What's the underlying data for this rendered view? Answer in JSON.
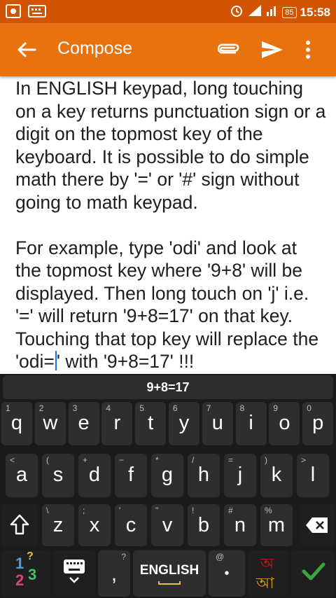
{
  "status_bar": {
    "battery": "85",
    "time": "15:58",
    "network": "4G"
  },
  "app_bar": {
    "title": "Compose",
    "back_icon": "arrow-back-icon",
    "attach_icon": "paperclip-icon",
    "send_icon": "send-icon",
    "more_icon": "more-vert-icon"
  },
  "content": {
    "paragraph1": "In ENGLISH keypad, long touching on a key returns punctuation sign or a digit on the topmost key of the keyboard. It is possible to do simple math there by '=' or '#' sign without going to math keypad.",
    "paragraph2_before_cursor": "For example, type 'odi' and look at the topmost key where '9+8' will be displayed. Then long touch on 'j' i.e. '=' will return '9+8=17' on that key. Touching that top key will replace the 'odi=",
    "paragraph2_after_cursor": "' with '9+8=17' !!!"
  },
  "keyboard": {
    "suggestion": "9+8=17",
    "row1": [
      {
        "main": "q",
        "hint": "1"
      },
      {
        "main": "w",
        "hint": "2"
      },
      {
        "main": "e",
        "hint": "3"
      },
      {
        "main": "r",
        "hint": "4"
      },
      {
        "main": "t",
        "hint": "5"
      },
      {
        "main": "y",
        "hint": "6"
      },
      {
        "main": "u",
        "hint": "7"
      },
      {
        "main": "i",
        "hint": "8"
      },
      {
        "main": "o",
        "hint": "9"
      },
      {
        "main": "p",
        "hint": "0"
      }
    ],
    "row2": [
      {
        "main": "a",
        "hint": "<"
      },
      {
        "main": "s",
        "hint": "("
      },
      {
        "main": "d",
        "hint": "+"
      },
      {
        "main": "f",
        "hint": "−"
      },
      {
        "main": "g",
        "hint": "*"
      },
      {
        "main": "h",
        "hint": "/"
      },
      {
        "main": "j",
        "hint": "="
      },
      {
        "main": "k",
        "hint": ")"
      },
      {
        "main": "l",
        "hint": ">"
      }
    ],
    "row3": [
      {
        "main": "z",
        "hint": "\\"
      },
      {
        "main": "x",
        "hint": ";"
      },
      {
        "main": "c",
        "hint": "'"
      },
      {
        "main": "v",
        "hint": "\""
      },
      {
        "main": "b",
        "hint": "!"
      },
      {
        "main": "n",
        "hint": "#"
      },
      {
        "main": "m",
        "hint": "%"
      }
    ],
    "shift_icon": "shift-icon",
    "backspace_icon": "backspace-icon",
    "numbers_label_1": "1",
    "numbers_label_2": "?",
    "numbers_label_3": "2",
    "numbers_label_4": "3",
    "keyboard_icon": "keyboard-icon",
    "comma": ",",
    "comma_hint": "?",
    "space_label": "ENGLISH",
    "period": "•",
    "period_hint": "@",
    "bengali_top": "অ",
    "bengali_bottom": "আ",
    "enter_icon": "check-icon",
    "colors": {
      "suggestion_bg": "#2d2d2d",
      "key_bg": "#2e2e2e",
      "accent_check": "#3aa63a",
      "bengali_red": "#d01414",
      "bengali_orange": "#e89a1a"
    }
  }
}
